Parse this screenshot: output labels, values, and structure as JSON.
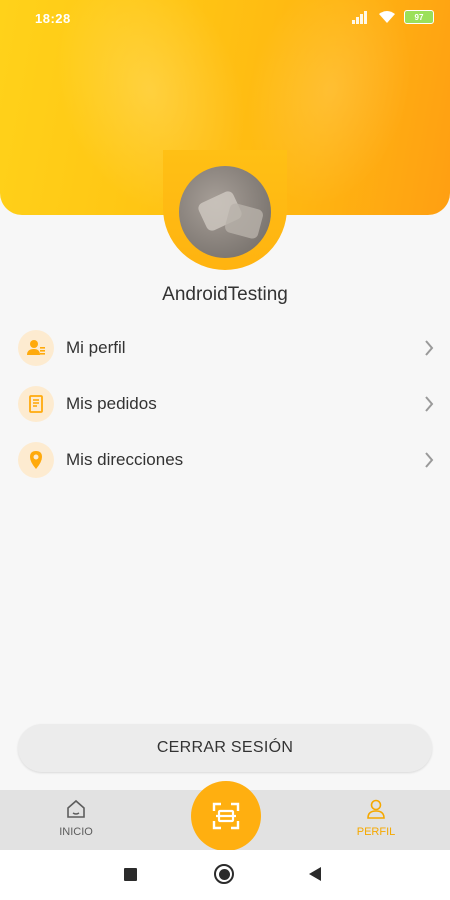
{
  "status_bar": {
    "time": "18:28",
    "battery": "97"
  },
  "profile": {
    "username": "AndroidTesting"
  },
  "menu": [
    {
      "label": "Mi perfil",
      "icon": "user-card-icon"
    },
    {
      "label": "Mis pedidos",
      "icon": "receipt-icon"
    },
    {
      "label": "Mis direcciones",
      "icon": "location-pin-icon"
    }
  ],
  "logout_label": "CERRAR SESIÓN",
  "bottom_nav": {
    "inicio_label": "INICIO",
    "perfil_label": "PERFIL",
    "active": "PERFIL"
  },
  "colors": {
    "accent": "#ffaf10",
    "active_nav": "#f5a800"
  }
}
